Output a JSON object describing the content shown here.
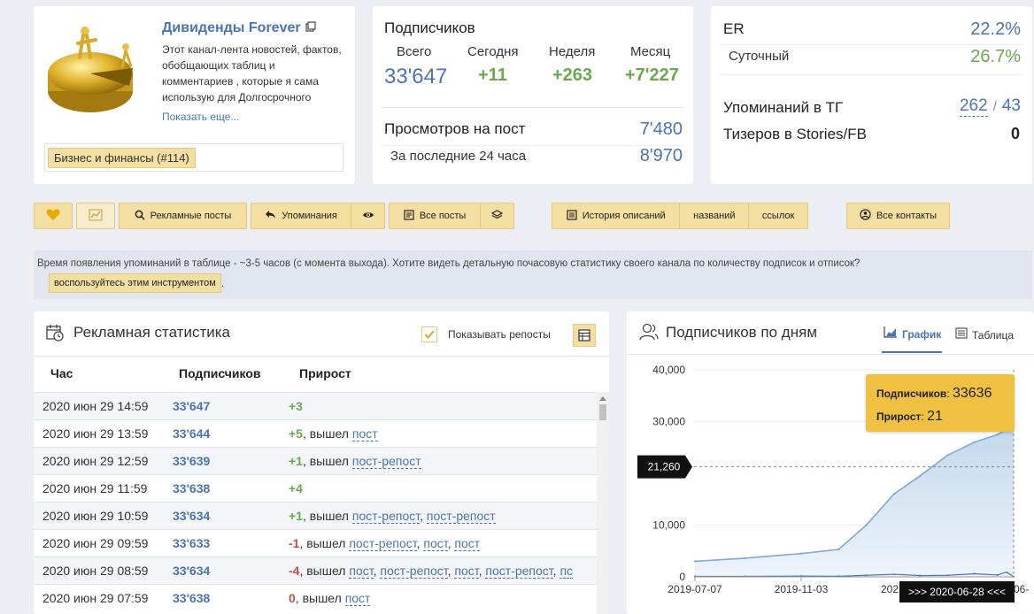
{
  "channel": {
    "title": "Дивиденды Forever",
    "description": "Этот канал-лента новостей, фактов, обобщающих таблиц и комментариев , которые я сама использую для Долгосрочного",
    "show_more": "Показать еще...",
    "category": "Бизнес и финансы (#114)"
  },
  "subscribers": {
    "title": "Подписчиков",
    "total_label": "Всего",
    "total": "33'647",
    "today_label": "Сегодня",
    "today": "+11",
    "week_label": "Неделя",
    "week": "+263",
    "month_label": "Месяц",
    "month": "+7'227",
    "views_label": "Просмотров на пост",
    "views": "7'480",
    "views24_label": "За последние 24 часа",
    "views24": "8'970"
  },
  "engagement": {
    "er_label": "ER",
    "er": "22.2%",
    "daily_label": "Суточный",
    "daily": "26.7%",
    "mentions_label": "Упоминаний в ТГ",
    "mentions_a": "262",
    "mentions_sep": "/",
    "mentions_b": "43",
    "teasers_label": "Тизеров в Stories/FB",
    "teasers": "0"
  },
  "toolbar": {
    "ads": "Рекламные посты",
    "mentions": "Упоминания",
    "all_posts": "Все посты",
    "desc_history": "История описаний",
    "names": "названий",
    "links": "ссылок",
    "contacts": "Все контакты"
  },
  "notice": {
    "text": "Время появления упоминаний в таблице - ~3-5 часов (с момента выхода). Хотите видеть детальную почасовую статистику своего канала по количеству подписок и отписок?",
    "button": "воспользуйтесь этим инструментом",
    "tail": "."
  },
  "ad_stats": {
    "title": "Рекламная статистика",
    "show_reposts": "Показывать репосты",
    "columns": [
      "Час",
      "Подписчиков",
      "Прирост"
    ],
    "rows": [
      {
        "time": "2020 июн 29 14:59",
        "subs": "33'647",
        "delta": "+3",
        "note": "",
        "links": []
      },
      {
        "time": "2020 июн 29 13:59",
        "subs": "33'644",
        "delta": "+5",
        "note": ", вышел ",
        "links": [
          "пост"
        ]
      },
      {
        "time": "2020 июн 29 12:59",
        "subs": "33'639",
        "delta": "+1",
        "note": ", вышел ",
        "links": [
          "пост-репост"
        ]
      },
      {
        "time": "2020 июн 29 11:59",
        "subs": "33'638",
        "delta": "+4",
        "note": "",
        "links": []
      },
      {
        "time": "2020 июн 29 10:59",
        "subs": "33'634",
        "delta": "+1",
        "note": ", вышел ",
        "links": [
          "пост-репост",
          "пост-репост"
        ]
      },
      {
        "time": "2020 июн 29 09:59",
        "subs": "33'633",
        "delta": "-1",
        "note": ", вышел ",
        "links": [
          "пост-репост",
          "пост",
          "пост"
        ]
      },
      {
        "time": "2020 июн 29 08:59",
        "subs": "33'634",
        "delta": "-4",
        "note": ", вышел ",
        "links": [
          "пост",
          "пост-репост",
          "пост",
          "пост-репост",
          "пс"
        ]
      },
      {
        "time": "2020 июн 29 07:59",
        "subs": "33'638",
        "delta": "0",
        "note": ", вышел ",
        "links": [
          "пост"
        ]
      }
    ]
  },
  "daily_chart": {
    "title": "Подписчиков по дням",
    "tab_chart": "График",
    "tab_table": "Таблица",
    "tooltip_subs_label": "Подписчиков",
    "tooltip_subs": "33636",
    "tooltip_delta_label": "Прирост",
    "tooltip_delta": "21",
    "crosshair_y_label": "21,260",
    "crosshair_x_label": ">>> 2020-06-28 <<<",
    "x_tick_partial_left": "202",
    "x_tick_partial_right": "06-"
  },
  "chart_data": {
    "type": "area",
    "x_ticks": [
      "2019-07-07",
      "2019-11-03"
    ],
    "y_ticks": [
      "0",
      "10,000",
      "30,000",
      "40,000"
    ],
    "ylim": [
      0,
      40000
    ],
    "x": [
      "2019-07-07",
      "2019-09-01",
      "2019-11-03",
      "2019-12-15",
      "2020-01-15",
      "2020-02-15",
      "2020-03-15",
      "2020-04-15",
      "2020-05-15",
      "2020-06-10",
      "2020-06-20",
      "2020-06-28"
    ],
    "series": [
      {
        "values": [
          3000,
          3600,
          4500,
          5300,
          10000,
          16000,
          19500,
          23500,
          26000,
          27500,
          28500,
          33636
        ]
      },
      {
        "values": [
          100,
          100,
          150,
          120,
          300,
          500,
          250,
          300,
          600,
          350,
          900,
          21
        ]
      }
    ]
  }
}
